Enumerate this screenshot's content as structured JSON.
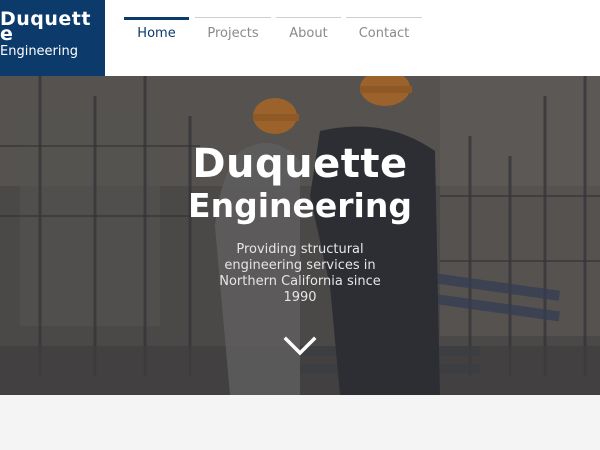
{
  "brand": {
    "name_line1": "Duquette",
    "name_line2": "Engineering",
    "color": "#0b3a6b"
  },
  "nav": {
    "items": [
      {
        "label": "Home",
        "active": true
      },
      {
        "label": "Projects",
        "active": false
      },
      {
        "label": "About",
        "active": false
      },
      {
        "label": "Contact",
        "active": false
      }
    ]
  },
  "hero": {
    "title": "Duquette",
    "subtitle": "Engineering",
    "description": "Providing structural engineering services in Northern California since 1990",
    "scroll_icon": "chevron-down-icon"
  }
}
